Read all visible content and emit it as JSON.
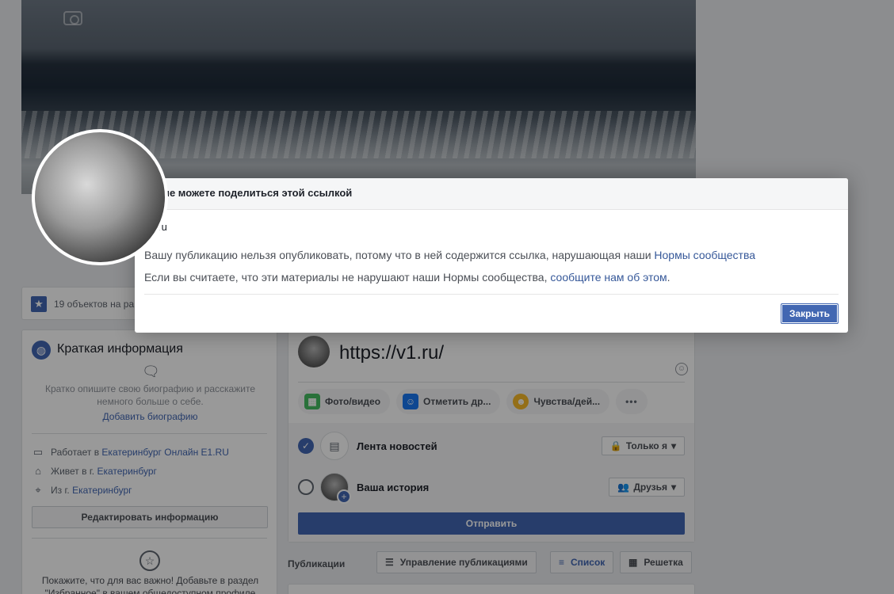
{
  "profile": {
    "objects_text": "19 объектов на ра",
    "intro": {
      "title": "Краткая информация",
      "description": "Кратко опишите свою биографию и расскажите немного больше о себе.",
      "add_bio": "Добавить биографию",
      "work_prefix": "Работает в",
      "work_link": "Екатеринбург Онлайн E1.RU",
      "lives_prefix": "Живет в г.",
      "lives_link": "Екатеринбург",
      "from_prefix": "Из г.",
      "from_link": "Екатеринбург",
      "edit_button": "Редактировать информацию",
      "favorites_text": "Покажите, что для вас важно! Добавьте в раздел \"Избранное\" в вашем общедоступном профиле свои"
    }
  },
  "composer": {
    "post_text": "https://v1.ru/",
    "chips": [
      "Фото/видео",
      "Отметить др...",
      "Чувства/дей...",
      "•••"
    ],
    "destinations": [
      {
        "label": "Лента новостей",
        "privacy": "Только я",
        "checked": true
      },
      {
        "label": "Ваша история",
        "privacy": "Друзья",
        "checked": false
      }
    ],
    "send_button": "Отправить"
  },
  "publications": {
    "title": "Публикации",
    "manage": "Управление публикациями",
    "list": "Список",
    "grid": "Решетка"
  },
  "dialog": {
    "title": "Вы не можете поделиться этой ссылкой",
    "domain": "v1.ru",
    "message_prefix": "Вашу публикацию нельзя опубликовать, потому что в ней содержится ссылка, нарушающая наши",
    "message_link": "Нормы сообщества",
    "message2_prefix": "Если вы считаете, что эти материалы не нарушают наши Нормы сообщества,",
    "message2_link": "сообщите нам об этом",
    "message2_suffix": ".",
    "close_button": "Закрыть"
  },
  "colors": {
    "accent": "#4267b2",
    "link": "#365899",
    "background": "#e9ebee"
  }
}
